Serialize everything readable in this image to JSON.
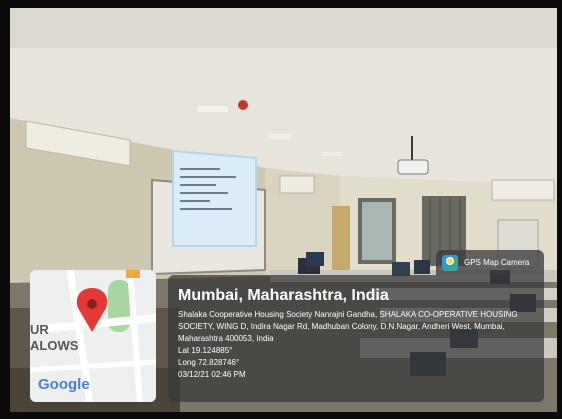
{
  "overlay": {
    "app_name": "GPS Map Camera",
    "app_icon": "gps-map-camera-icon",
    "location_title": "Mumbai, Maharashtra, India",
    "address": "Shalaka Cooperative Housing Society Nanrajni Gandha, SHALAKA CO-OPERATIVE HOUSING SOCIETY, WING D, Indira Nagar Rd, Madhuban Colony, D.N.Nagar, Andheri West, Mumbai, Maharashtra 400053, India",
    "latitude": "Lat 19.124885°",
    "longitude": "Long 72.828746°",
    "datetime": "03/12/21 02:46 PM"
  },
  "map": {
    "brand": "Google",
    "label_line1": "UR",
    "label_line2": "ALOWS",
    "marker_icon": "map-pin-icon",
    "marker_color": "#e53935"
  },
  "scene": {
    "description_icons": [
      "ceiling",
      "air-conditioner",
      "projector-screen",
      "whiteboard",
      "projector",
      "window",
      "computer-monitors",
      "desks"
    ]
  }
}
